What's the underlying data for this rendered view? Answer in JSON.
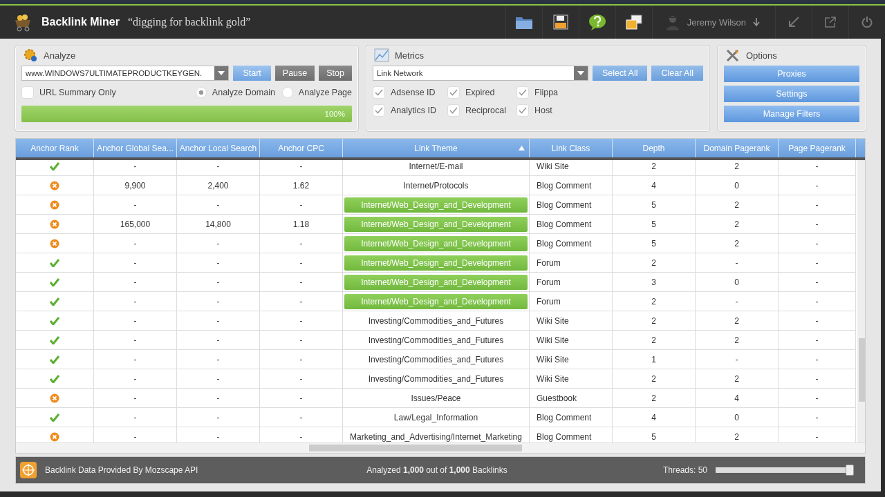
{
  "app": {
    "name": "Backlink Miner",
    "tagline": "“digging for backlink gold”",
    "user": "Jeremy Wilson"
  },
  "analyze": {
    "title": "Analyze",
    "url": "www.WINDOWS7ULTIMATEPRODUCTKEYGEN.",
    "buttons": [
      {
        "label": "Start",
        "kind": "primary"
      },
      {
        "label": "Pause",
        "kind": "dark"
      },
      {
        "label": "Stop",
        "kind": "dark"
      }
    ],
    "url_summary": {
      "label": "URL Summary Only",
      "checked": false
    },
    "modes": [
      {
        "label": "Analyze Domain",
        "selected": true
      },
      {
        "label": "Analyze Page",
        "selected": false
      }
    ],
    "progress": {
      "level": 1,
      "reading": "100%"
    }
  },
  "metrics": {
    "title": "Metrics",
    "network": "Link Network",
    "buttons": [
      "Select All",
      "Clear All"
    ],
    "checks": [
      {
        "label": "Adsense ID",
        "checked": true
      },
      {
        "label": "Expired",
        "checked": true
      },
      {
        "label": "Flippa",
        "checked": true
      },
      {
        "label": "Analytics ID",
        "checked": true
      },
      {
        "label": "Reciprocal",
        "checked": true
      },
      {
        "label": "Host",
        "checked": true
      }
    ]
  },
  "options": {
    "title": "Options",
    "buttons": [
      "Proxies",
      "Settings",
      "Manage Filters"
    ]
  },
  "table": {
    "columns": [
      {
        "label": "Anchor Rank",
        "sorted": false
      },
      {
        "label": "Anchor Global Sea...",
        "sorted": false
      },
      {
        "label": "Anchor Local Search",
        "sorted": false
      },
      {
        "label": "Anchor CPC",
        "sorted": false
      },
      {
        "label": "Link Theme",
        "sorted": true
      },
      {
        "label": "Link Class",
        "sorted": false
      },
      {
        "label": "Depth",
        "sorted": false
      },
      {
        "label": "Domain Pagerank",
        "sorted": false
      },
      {
        "label": "Page Pagerank",
        "sorted": false
      }
    ],
    "rows": [
      {
        "passed": true,
        "highlighted": false,
        "cells": [
          "",
          "-",
          "-",
          "-",
          "Internet/E-mail",
          "Wiki Site",
          "2",
          "2",
          "-"
        ]
      },
      {
        "passed": false,
        "highlighted": false,
        "cells": [
          "",
          "9,900",
          "2,400",
          "1.62",
          "Internet/Protocols",
          "Blog Comment",
          "4",
          "0",
          "-"
        ]
      },
      {
        "passed": false,
        "highlighted": true,
        "cells": [
          "",
          "-",
          "-",
          "-",
          "Internet/Web_Design_and_Development",
          "Blog Comment",
          "5",
          "2",
          "-"
        ]
      },
      {
        "passed": false,
        "highlighted": true,
        "cells": [
          "",
          "165,000",
          "14,800",
          "1.18",
          "Internet/Web_Design_and_Development",
          "Blog Comment",
          "5",
          "2",
          "-"
        ]
      },
      {
        "passed": false,
        "highlighted": true,
        "cells": [
          "",
          "-",
          "-",
          "-",
          "Internet/Web_Design_and_Development",
          "Blog Comment",
          "5",
          "2",
          "-"
        ]
      },
      {
        "passed": true,
        "highlighted": true,
        "cells": [
          "",
          "-",
          "-",
          "-",
          "Internet/Web_Design_and_Development",
          "Forum",
          "2",
          "-",
          "-"
        ]
      },
      {
        "passed": true,
        "highlighted": true,
        "cells": [
          "",
          "-",
          "-",
          "-",
          "Internet/Web_Design_and_Development",
          "Forum",
          "3",
          "0",
          "-"
        ]
      },
      {
        "passed": true,
        "highlighted": true,
        "cells": [
          "",
          "-",
          "-",
          "-",
          "Internet/Web_Design_and_Development",
          "Forum",
          "2",
          "-",
          "-"
        ]
      },
      {
        "passed": true,
        "highlighted": false,
        "cells": [
          "",
          "-",
          "-",
          "-",
          "Investing/Commodities_and_Futures",
          "Wiki Site",
          "2",
          "2",
          "-"
        ]
      },
      {
        "passed": true,
        "highlighted": false,
        "cells": [
          "",
          "-",
          "-",
          "-",
          "Investing/Commodities_and_Futures",
          "Wiki Site",
          "2",
          "2",
          "-"
        ]
      },
      {
        "passed": true,
        "highlighted": false,
        "cells": [
          "",
          "-",
          "-",
          "-",
          "Investing/Commodities_and_Futures",
          "Wiki Site",
          "1",
          "-",
          "-"
        ]
      },
      {
        "passed": true,
        "highlighted": false,
        "cells": [
          "",
          "-",
          "-",
          "-",
          "Investing/Commodities_and_Futures",
          "Wiki Site",
          "2",
          "2",
          "-"
        ]
      },
      {
        "passed": false,
        "highlighted": false,
        "cells": [
          "",
          "-",
          "-",
          "-",
          "Issues/Peace",
          "Guestbook",
          "2",
          "4",
          "-"
        ]
      },
      {
        "passed": true,
        "highlighted": false,
        "cells": [
          "",
          "-",
          "-",
          "-",
          "Law/Legal_Information",
          "Blog Comment",
          "4",
          "0",
          "-"
        ]
      },
      {
        "passed": false,
        "highlighted": false,
        "cells": [
          "",
          "-",
          "-",
          "-",
          "Marketing_and_Advertising/Internet_Marketing",
          "Blog Comment",
          "5",
          "2",
          "-"
        ]
      }
    ]
  },
  "status_bar": {
    "provider": "Backlink Data Provided By Mozscape API",
    "summary": "Analyzed **1,000** out of **1,000** Backlinks",
    "threads": {
      "label": "Threads: 50",
      "level": 1
    }
  }
}
